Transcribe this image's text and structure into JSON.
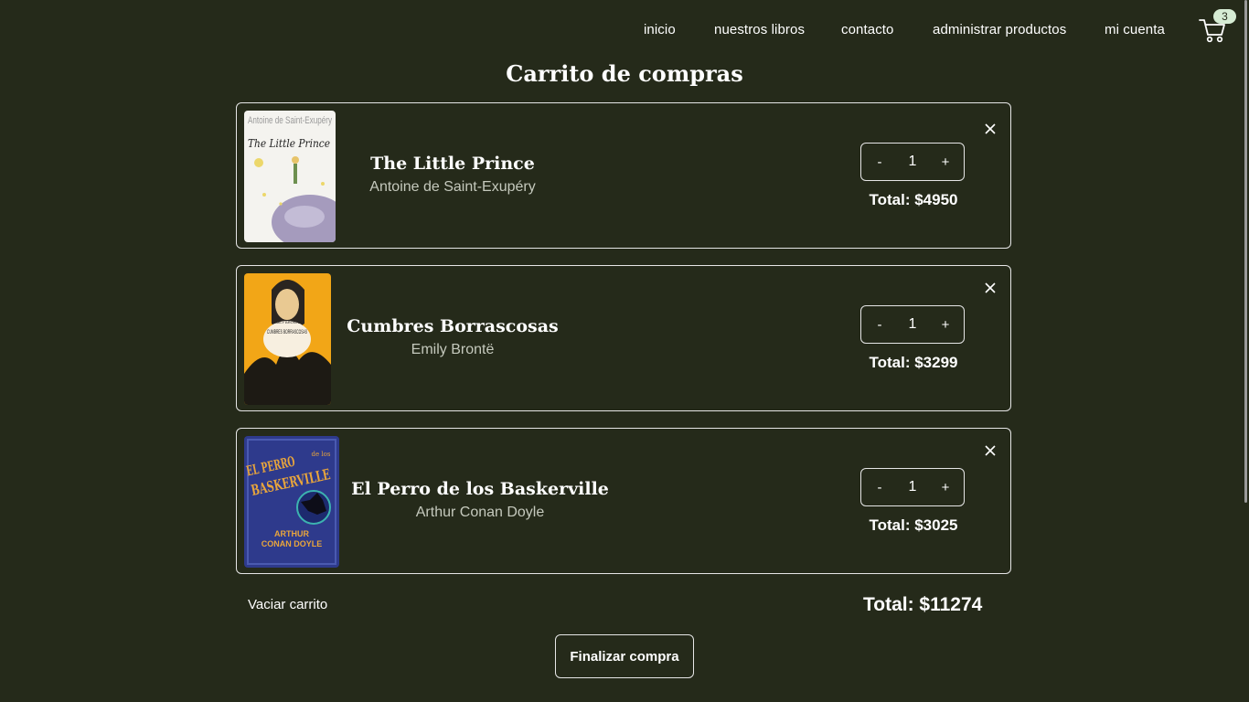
{
  "nav": {
    "items": [
      {
        "label": "inicio"
      },
      {
        "label": "nuestros libros"
      },
      {
        "label": "contacto"
      },
      {
        "label": "administrar productos"
      },
      {
        "label": "mi cuenta"
      }
    ],
    "cart_count": "3",
    "cart_icon": "shopping-cart-icon"
  },
  "page": {
    "title": "Carrito de compras"
  },
  "cart": {
    "items": [
      {
        "title": "The Little Prince",
        "author": "Antoine de Saint-Exupéry",
        "qty": "1",
        "minus": "-",
        "plus": "+",
        "total": "Total: $4950",
        "cover_author": "Antoine de Saint-Exupéry",
        "cover_title": "The Little Prince"
      },
      {
        "title": "Cumbres Borrascosas",
        "author": "Emily Brontë",
        "qty": "1",
        "minus": "-",
        "plus": "+",
        "total": "Total: $3299",
        "cover_author": "EMILY BRONTË",
        "cover_title": "CUMBRES BORRASCOSAS"
      },
      {
        "title": "El Perro de los Baskerville",
        "author": "Arthur Conan Doyle",
        "qty": "1",
        "minus": "-",
        "plus": "+",
        "total": "Total: $3025",
        "cover_title_line1": "EL PERRO",
        "cover_title_line2": "de los",
        "cover_title_line3": "BASKERVILLE",
        "cover_author_line1": "ARTHUR",
        "cover_author_line2": "CONAN DOYLE"
      }
    ],
    "empty_label": "Vaciar carrito",
    "grand_total": "Total: $11274",
    "checkout_label": "Finalizar compra"
  },
  "colors": {
    "background": "#252a1a",
    "text": "#ffffff",
    "muted": "#c5c9bd",
    "badge": "#d6ecd4"
  }
}
